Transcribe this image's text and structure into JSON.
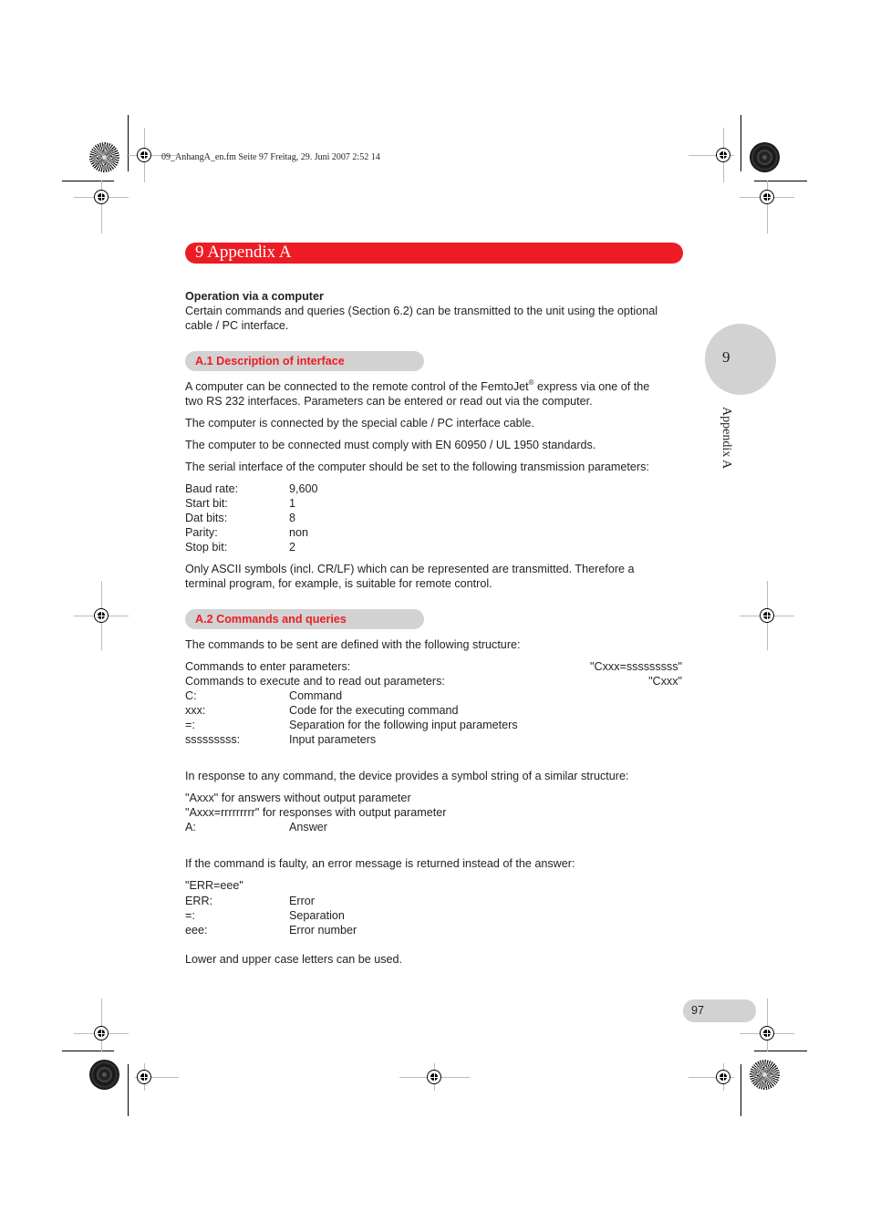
{
  "slug_line": "09_AnhangA_en.fm  Seite 97  Freitag, 29. Juni 2007  2:52 14",
  "chapter": {
    "title": "9  Appendix A"
  },
  "side_tab": {
    "number": "9",
    "label": "Appendix A"
  },
  "intro": {
    "heading": "Operation via a computer",
    "lines": [
      "Certain commands and queries (Section 6.2) can be transmitted to the unit using the optional",
      "cable / PC interface."
    ]
  },
  "section_a1": {
    "title": "A.1  Description of interface",
    "p1_line1_pre": "A computer can be connected to the remote control of the FemtoJet",
    "p1_line1_sup": "®",
    "p1_line1_post": " express via one of the",
    "p1_line2": "two RS 232 interfaces. Parameters can be entered or read out via the computer.",
    "p2": "The computer is connected by the special cable / PC interface cable.",
    "p3": "The computer to be connected must comply with EN 60950 / UL 1950 standards.",
    "p4": "The serial interface of the computer should be set to the following transmission parameters:",
    "params": [
      {
        "key": "Baud rate:",
        "value": "9,600"
      },
      {
        "key": "Start bit:",
        "value": "1"
      },
      {
        "key": "Dat bits:",
        "value": "8"
      },
      {
        "key": "Parity:",
        "value": "non"
      },
      {
        "key": "Stop bit:",
        "value": "2"
      }
    ],
    "p5_line1": "Only ASCII symbols (incl. CR/LF) which can be represented are transmitted. Therefore a",
    "p5_line2": "terminal program, for example, is suitable for remote control."
  },
  "section_a2": {
    "title": "A.2  Commands and queries",
    "intro": "The commands to be sent are defined with the following structure:",
    "structure": [
      {
        "label": "Commands to enter parameters:",
        "value": "\"Cxxx=sssssssss\""
      },
      {
        "label": "Commands to execute and to read out parameters:",
        "value": "\"Cxxx\""
      }
    ],
    "cmd_defs": [
      {
        "key": "C:",
        "value": "Command"
      },
      {
        "key": "xxx:",
        "value": "Code for the executing command"
      },
      {
        "key": "=:",
        "value": "Separation for the following input parameters"
      },
      {
        "key": "sssssssss:",
        "value": "Input parameters"
      }
    ],
    "response_intro": "In response to any command, the device provides a symbol string of a similar structure:",
    "response_lines": [
      "\"Axxx\" for answers without output parameter",
      "\"Axxx=rrrrrrrrr\" for responses with output parameter"
    ],
    "answer_def": {
      "key": "A:",
      "value": "Answer"
    },
    "error_intro": "If the command is faulty, an error message is returned instead of the answer:",
    "error_format": "\"ERR=eee\"",
    "error_defs": [
      {
        "key": "ERR:",
        "value": "Error"
      },
      {
        "key": "=:",
        "value": "Separation"
      },
      {
        "key": "eee:",
        "value": "Error number"
      }
    ],
    "closing": "Lower and upper case letters can be used."
  },
  "footer": {
    "page_number": "97"
  }
}
